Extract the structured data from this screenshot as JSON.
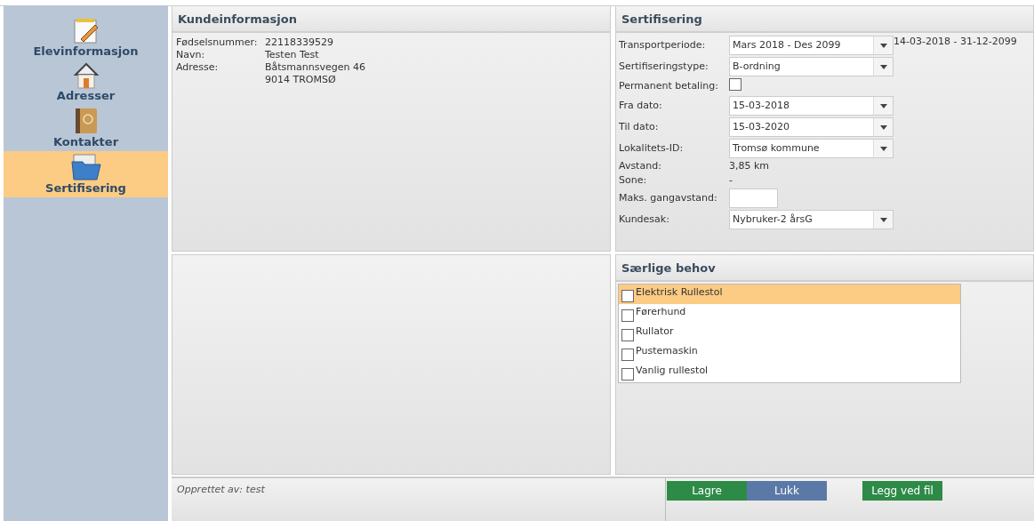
{
  "sidebar": {
    "items": [
      {
        "label": "Elevinformasjon",
        "kind": "notepad",
        "selected": false
      },
      {
        "label": "Adresser",
        "kind": "house",
        "selected": false
      },
      {
        "label": "Kontakter",
        "kind": "book",
        "selected": false
      },
      {
        "label": "Sertifisering",
        "kind": "folder",
        "selected": true
      }
    ]
  },
  "customer": {
    "title": "Kundeinformasjon",
    "rows": [
      {
        "label": "Fødselsnummer:",
        "lines": [
          "22118339529"
        ]
      },
      {
        "label": "Navn:",
        "lines": [
          "Testen Test"
        ]
      },
      {
        "label": "Adresse:",
        "lines": [
          "Båtsmannsvegen 46",
          "9014 TROMSØ"
        ]
      }
    ]
  },
  "certification": {
    "title": "Sertifisering",
    "fields": [
      {
        "kind": "select",
        "label": "Transportperiode:",
        "value": "Mars 2018 - Des 2099",
        "note": "14-03-2018 - 31-12-2099"
      },
      {
        "kind": "select",
        "label": "Sertifiseringstype:",
        "value": "B-ordning"
      },
      {
        "kind": "checkbox",
        "label": "Permanent betaling:",
        "checked": false
      },
      {
        "kind": "select",
        "label": "Fra dato:",
        "value": "15-03-2018"
      },
      {
        "kind": "select",
        "label": "Til dato:",
        "value": "15-03-2020"
      },
      {
        "kind": "select",
        "label": "Lokalitets-ID:",
        "value": "Tromsø kommune"
      },
      {
        "kind": "text",
        "label": "Avstand:",
        "value": "3,85 km"
      },
      {
        "kind": "text",
        "label": "Sone:",
        "value": "-"
      },
      {
        "kind": "input",
        "label": "Maks. gangavstand:"
      },
      {
        "kind": "select",
        "label": "Kundesak:",
        "value": "Nybruker-2 årsG"
      }
    ]
  },
  "special_needs": {
    "title": "Særlige behov",
    "items": [
      {
        "label": "Elektrisk Rullestol",
        "checked": false,
        "selected": true
      },
      {
        "label": "Førerhund",
        "checked": false,
        "selected": false
      },
      {
        "label": "Rullator",
        "checked": false,
        "selected": false
      },
      {
        "label": "Pustemaskin",
        "checked": false,
        "selected": false
      },
      {
        "label": "Vanlig rullestol",
        "checked": false,
        "selected": false
      }
    ]
  },
  "footer": {
    "created_by": "Opprettet av: test",
    "buttons": [
      {
        "label": "Lagre",
        "color": "#2e8b47"
      },
      {
        "label": "Lukk",
        "color": "#5b79a6"
      },
      {
        "label": "Legg ved fil",
        "color": "#2e8b47"
      }
    ]
  }
}
